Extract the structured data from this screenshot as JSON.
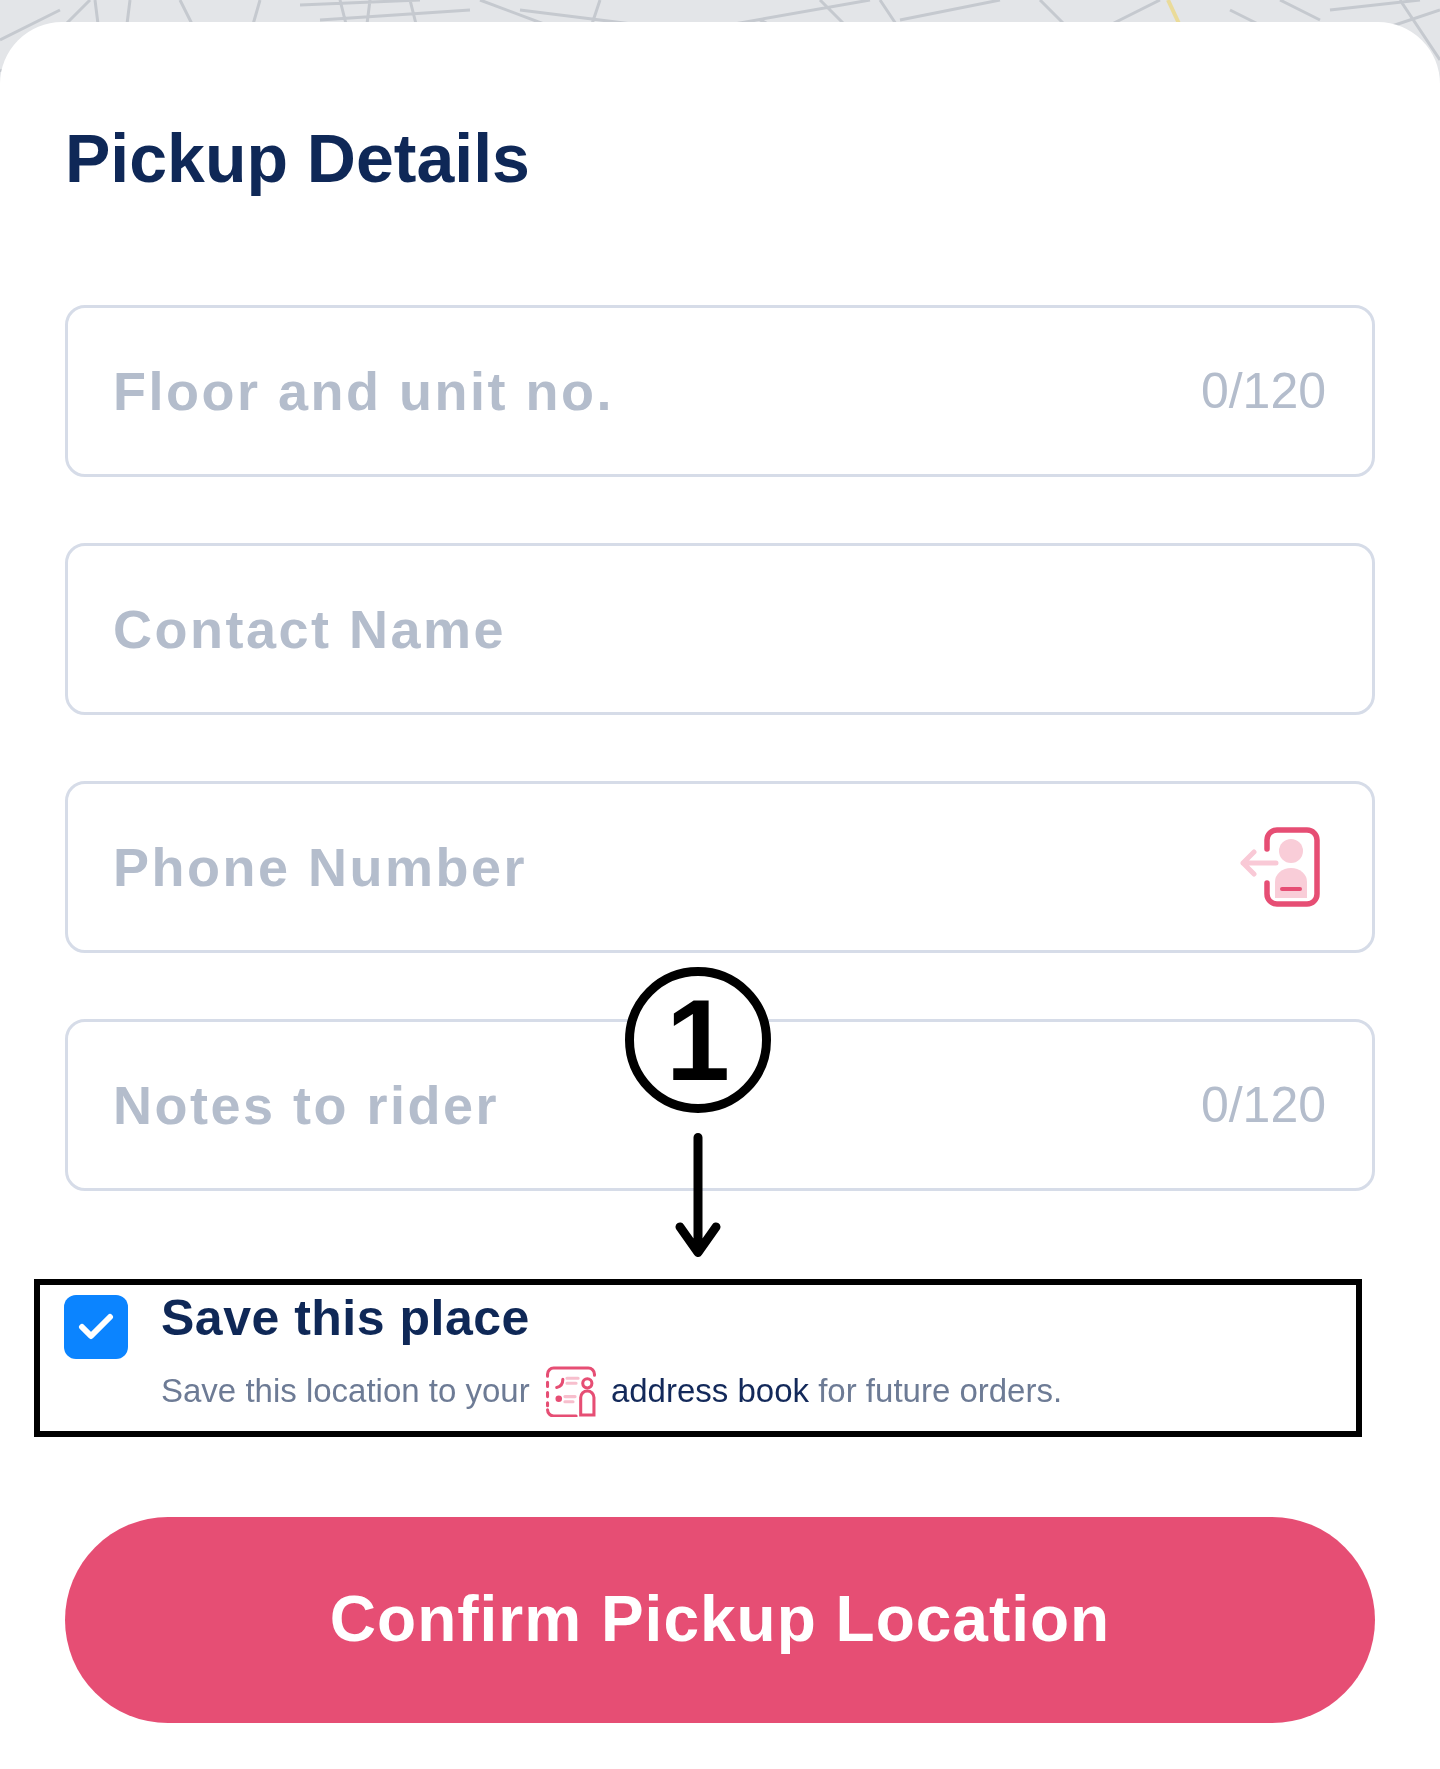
{
  "title": "Pickup Details",
  "fields": [
    {
      "kind": "counted",
      "placeholder": "Floor and unit no.",
      "counter": "0/120"
    },
    {
      "kind": "plain",
      "placeholder": "Contact Name"
    },
    {
      "kind": "phone",
      "placeholder": "Phone Number"
    },
    {
      "kind": "counted",
      "placeholder": "Notes to rider",
      "counter": "0/120"
    }
  ],
  "callout": {
    "number": "1"
  },
  "save_place": {
    "checked": true,
    "title": "Save this place",
    "text_before_link": "Save this location to your",
    "link": "address book",
    "text_after_link": "for future orders."
  },
  "confirm_button": {
    "label": "Confirm Pickup Location"
  }
}
